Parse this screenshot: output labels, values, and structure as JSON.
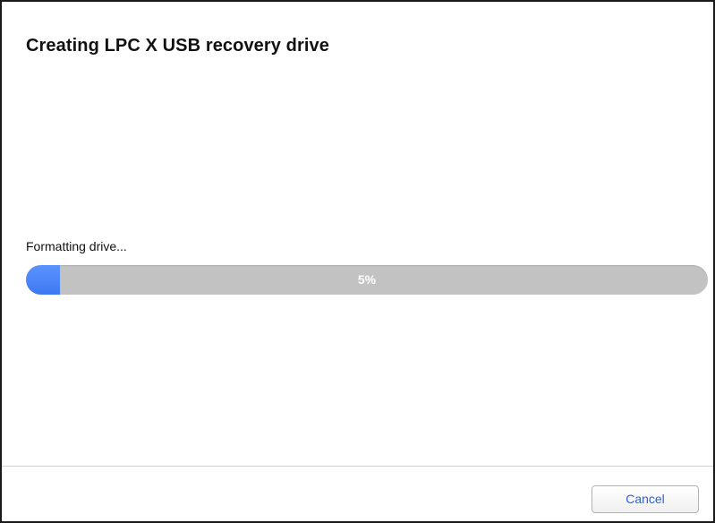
{
  "dialog": {
    "title": "Creating LPC X USB recovery drive",
    "status_text": "Formatting drive...",
    "progress": {
      "percent": 5,
      "label": "5%"
    },
    "buttons": {
      "cancel_label": "Cancel"
    }
  },
  "colors": {
    "progress_fill": "#4a86f7",
    "progress_track": "#c2c2c2",
    "button_text": "#2a63d6"
  }
}
